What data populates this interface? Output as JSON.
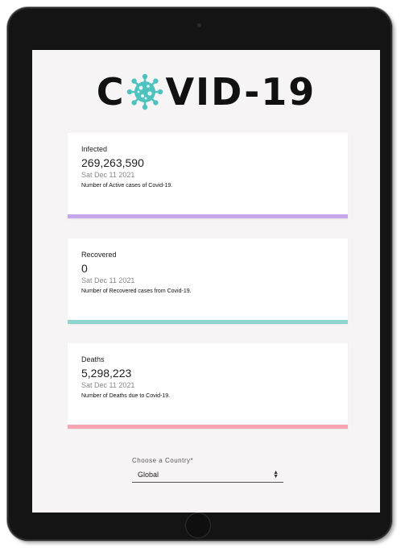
{
  "app": {
    "logo_text_left": "C",
    "logo_text_right": "VID-19",
    "logo_icon": "virus-icon",
    "colors": {
      "virus": "#4ec2bf",
      "infected_accent": "#c4a7ec",
      "recovered_accent": "#8fd3cf",
      "deaths_accent": "#f5a6b2"
    }
  },
  "cards": [
    {
      "title": "Infected",
      "value": "269,263,590",
      "date": "Sat Dec 11 2021",
      "description": "Number of Active cases of Covid-19."
    },
    {
      "title": "Recovered",
      "value": "0",
      "date": "Sat Dec 11 2021",
      "description": "Number of Recovered cases from Covid-19."
    },
    {
      "title": "Deaths",
      "value": "5,298,223",
      "date": "Sat Dec 11 2021",
      "description": "Number of Deaths due to Covid-19."
    }
  ],
  "country_select": {
    "label": "Choose a Country*",
    "selected": "Global"
  }
}
